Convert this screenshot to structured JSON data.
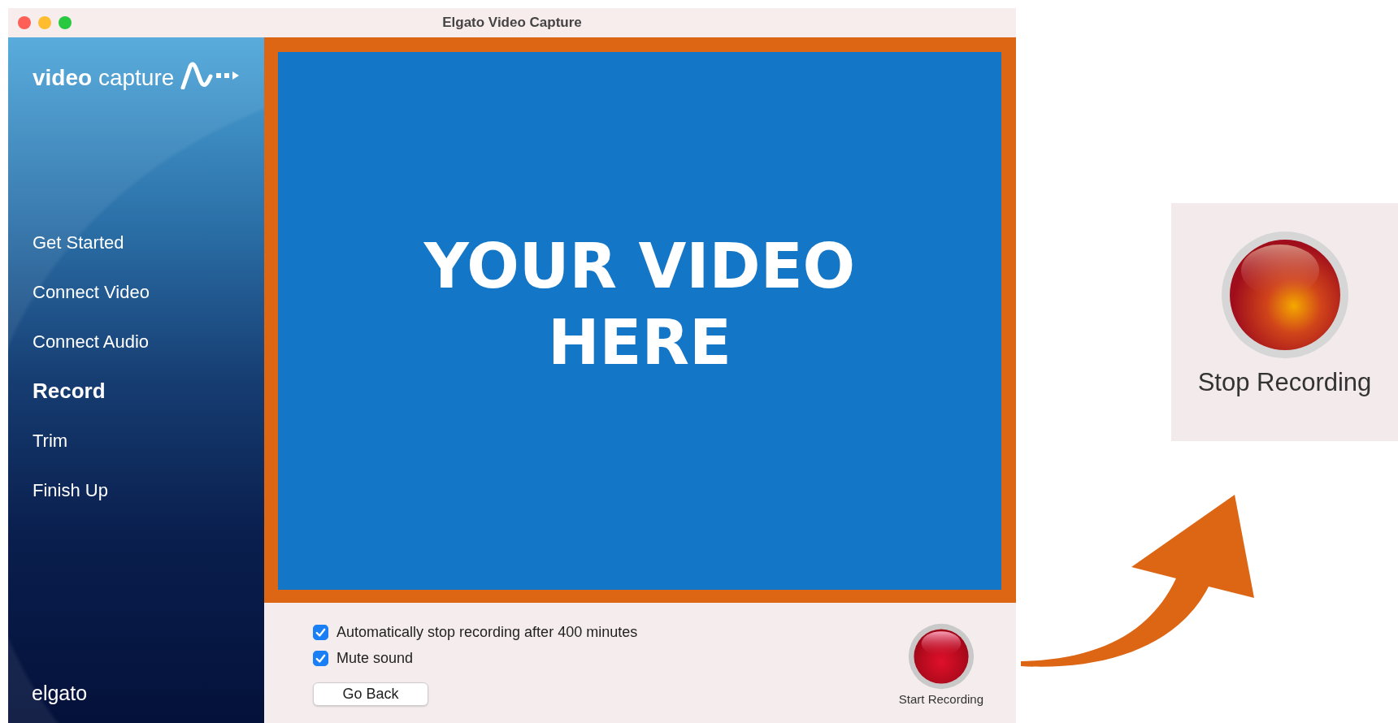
{
  "window": {
    "title": "Elgato Video Capture"
  },
  "sidebar": {
    "logo": "**video** capture",
    "items": [
      {
        "label": "Get Started",
        "selected": false
      },
      {
        "label": "Connect Video",
        "selected": false
      },
      {
        "label": "Connect Audio",
        "selected": false
      },
      {
        "label": "Record",
        "selected": true
      },
      {
        "label": "Trim",
        "selected": false
      },
      {
        "label": "Finish Up",
        "selected": false
      }
    ],
    "footer": "elgato"
  },
  "preview": {
    "lines": [
      "YOUR VIDEO",
      "HERE"
    ]
  },
  "options": [
    {
      "label": "Automatically stop recording after 400 minutes",
      "checked": true
    },
    {
      "label": "Mute sound",
      "checked": true
    }
  ],
  "back_button": "Go Back",
  "record_button": {
    "label": "Start Recording"
  },
  "callout": {
    "label": "Stop Recording"
  }
}
